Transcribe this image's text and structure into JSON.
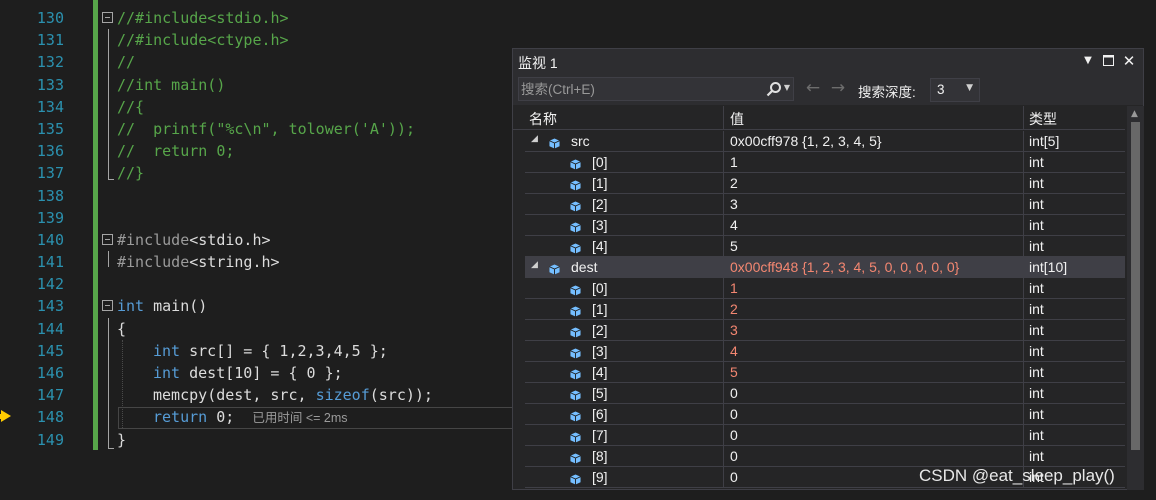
{
  "editor": {
    "line_numbers": [
      "130",
      "131",
      "132",
      "133",
      "134",
      "135",
      "136",
      "137",
      "138",
      "139",
      "140",
      "141",
      "142",
      "143",
      "144",
      "145",
      "146",
      "147",
      "148",
      "149"
    ],
    "lines": {
      "l130": "//#include<stdio.h>",
      "l131": "//#include<ctype.h>",
      "l132": "//",
      "l133": "//int main()",
      "l134": "//{",
      "l135": "//  printf(\"%c\\n\", tolower('A'));",
      "l136": "//  return 0;",
      "l137": "//}",
      "l140_a": "#include",
      "l140_b": "<stdio.h>",
      "l141_a": "#include",
      "l141_b": "<string.h>",
      "l143_kw": "int",
      "l143_fn": " main",
      "l143_rest": "()",
      "l144": "{",
      "l145_kw": "int",
      "l145_rest": " src[] = { 1,2,3,4,5 };",
      "l146_kw": "int",
      "l146_rest": " dest[10] = { 0 };",
      "l147_fn": "memcpy",
      "l147_a": "(dest, src, ",
      "l147_kw": "sizeof",
      "l147_b": "(src));",
      "l148_kw": "return",
      "l148_rest": " 0;",
      "l148_elapsed": "已用时间 <= 2ms",
      "l149": "}"
    }
  },
  "watch": {
    "title": "监视 1",
    "search_placeholder": "搜索(Ctrl+E)",
    "depth_label": "搜索深度:",
    "depth_value": "3",
    "columns": {
      "name": "名称",
      "value": "值",
      "type": "类型"
    },
    "rows": [
      {
        "name": "src",
        "value": "0x00cff978 {1, 2, 3, 4, 5}",
        "type": "int[5]"
      },
      {
        "name": "[0]",
        "value": "1",
        "type": "int"
      },
      {
        "name": "[1]",
        "value": "2",
        "type": "int"
      },
      {
        "name": "[2]",
        "value": "3",
        "type": "int"
      },
      {
        "name": "[3]",
        "value": "4",
        "type": "int"
      },
      {
        "name": "[4]",
        "value": "5",
        "type": "int"
      },
      {
        "name": "dest",
        "value": "0x00cff948 {1, 2, 3, 4, 5, 0, 0, 0, 0, 0}",
        "type": "int[10]"
      },
      {
        "name": "[0]",
        "value": "1",
        "type": "int"
      },
      {
        "name": "[1]",
        "value": "2",
        "type": "int"
      },
      {
        "name": "[2]",
        "value": "3",
        "type": "int"
      },
      {
        "name": "[3]",
        "value": "4",
        "type": "int"
      },
      {
        "name": "[4]",
        "value": "5",
        "type": "int"
      },
      {
        "name": "[5]",
        "value": "0",
        "type": "int"
      },
      {
        "name": "[6]",
        "value": "0",
        "type": "int"
      },
      {
        "name": "[7]",
        "value": "0",
        "type": "int"
      },
      {
        "name": "[8]",
        "value": "0",
        "type": "int"
      },
      {
        "name": "[9]",
        "value": "0",
        "type": "int"
      }
    ]
  },
  "watermark": "CSDN @eat_sleep_play()",
  "colors": {
    "background": "#1e1e1e",
    "comment": "#57a64a",
    "keyword": "#569cd6",
    "line_number": "#2b91af",
    "changed_value": "#f48771",
    "cube_icon": "#75beff",
    "exec_arrow": "#ffcc00"
  }
}
